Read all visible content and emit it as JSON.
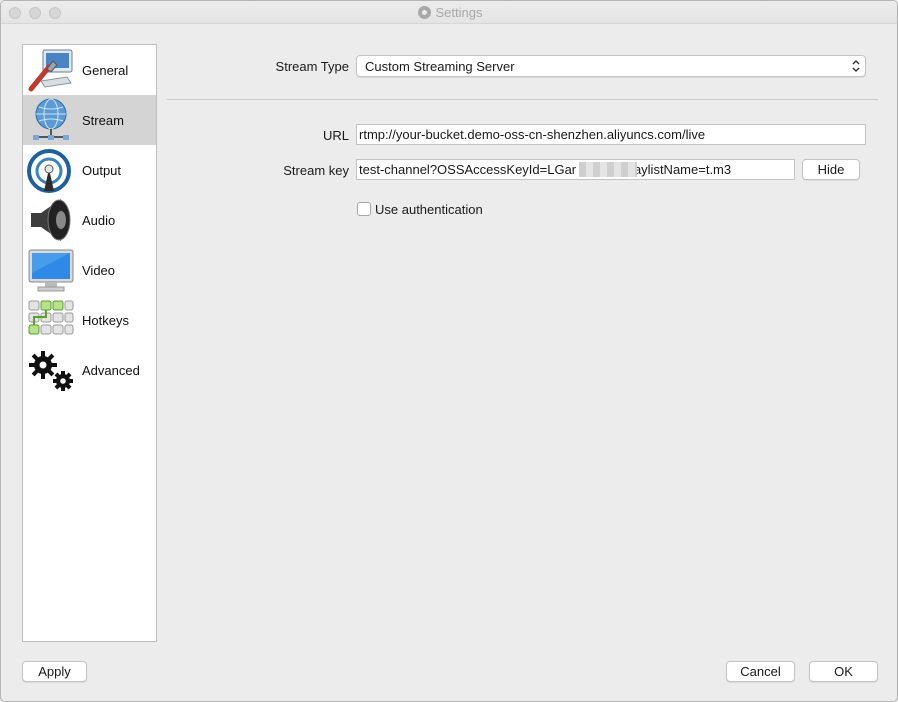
{
  "window": {
    "title": "Settings"
  },
  "sidebar": {
    "items": [
      {
        "label": "General",
        "icon": "general-icon",
        "selected": false
      },
      {
        "label": "Stream",
        "icon": "stream-globe-icon",
        "selected": true
      },
      {
        "label": "Output",
        "icon": "output-broadcast-icon",
        "selected": false
      },
      {
        "label": "Audio",
        "icon": "speaker-icon",
        "selected": false
      },
      {
        "label": "Video",
        "icon": "monitor-icon",
        "selected": false
      },
      {
        "label": "Hotkeys",
        "icon": "keyboard-icon",
        "selected": false
      },
      {
        "label": "Advanced",
        "icon": "gears-icon",
        "selected": false
      }
    ]
  },
  "stream": {
    "type_label": "Stream Type",
    "type_value": "Custom Streaming Server",
    "url_label": "URL",
    "url_value": "rtmp://your-bucket.demo-oss-cn-shenzhen.aliyuncs.com/live",
    "key_label": "Stream key",
    "key_value": "test-channel?OSSAccessKeyId=LGar               KWg6&playlistName=t.m3",
    "hide_label": "Hide",
    "auth_label": "Use authentication",
    "auth_checked": false
  },
  "footer": {
    "apply": "Apply",
    "cancel": "Cancel",
    "ok": "OK"
  }
}
